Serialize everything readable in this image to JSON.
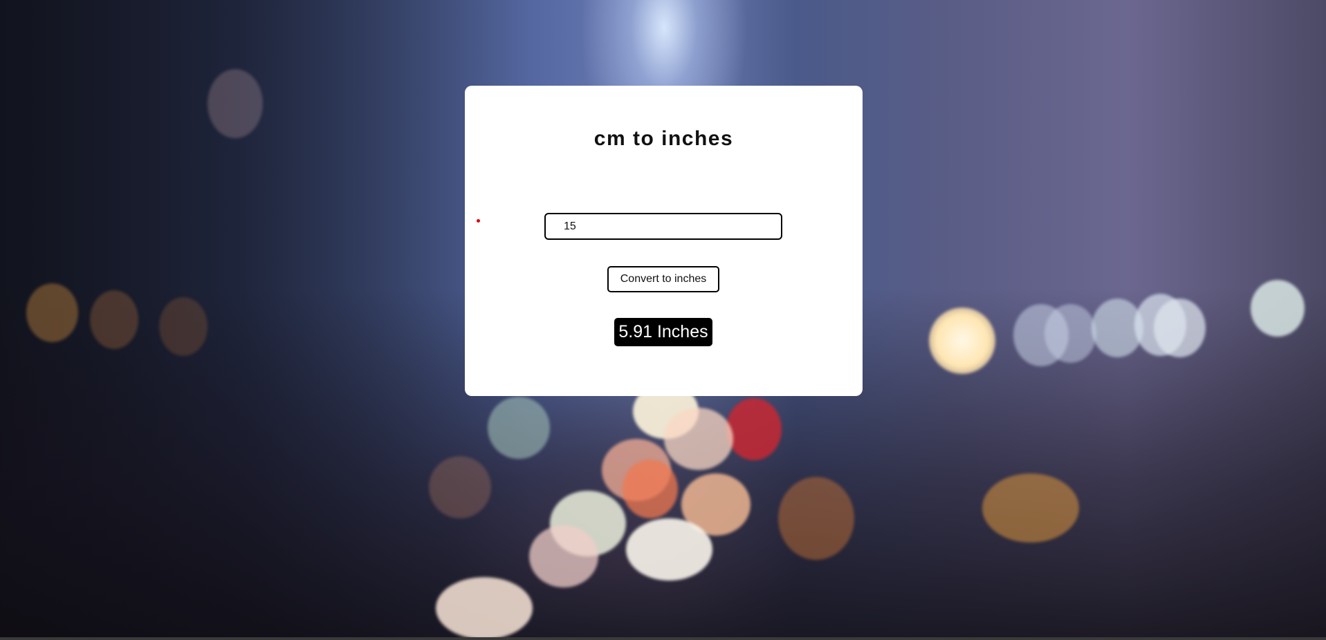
{
  "converter": {
    "title": "cm to inches",
    "input_value": "15",
    "button_label": "Convert to inches",
    "result_text": "5.91 Inches"
  },
  "colors": {
    "card_background": "#ffffff",
    "result_background": "#000000",
    "result_text": "#ffffff",
    "indicator_dot": "#e00000"
  }
}
